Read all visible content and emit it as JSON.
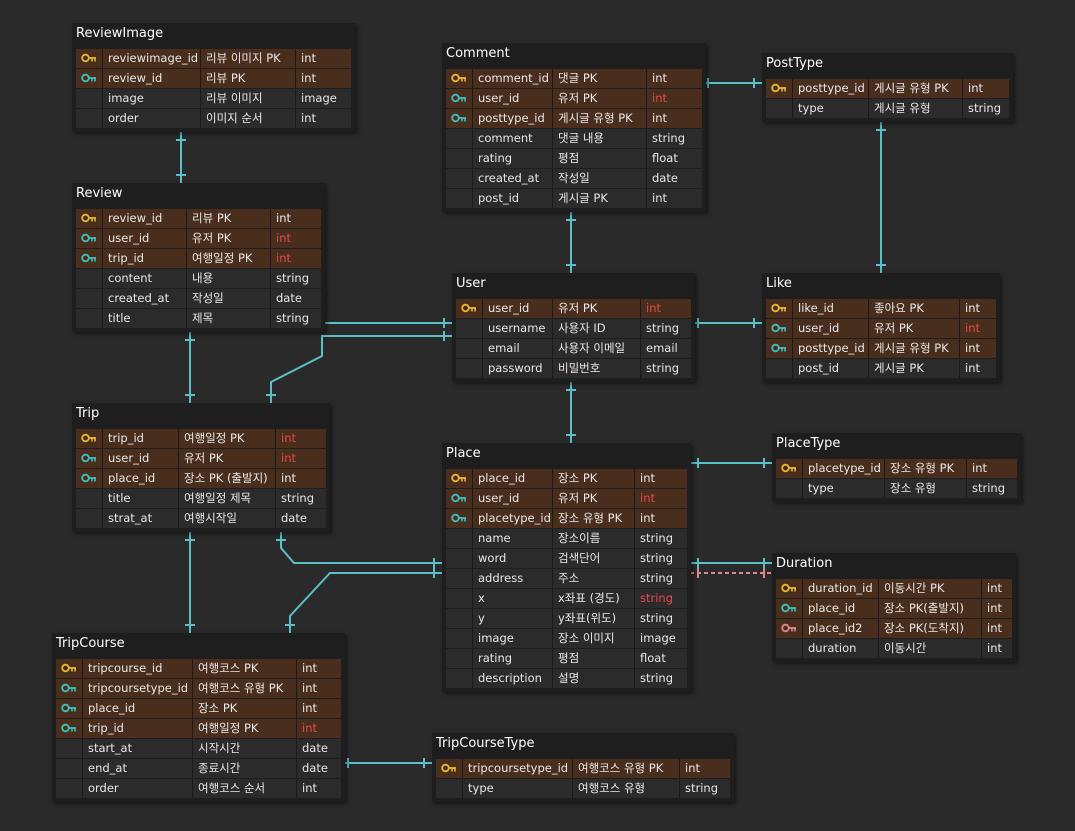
{
  "colors": {
    "background": "#2a2a2a",
    "table": "#1e1e1e",
    "key_row": "#4a2e1d",
    "cell": "#2b2b2b",
    "link": "#5bc0c8",
    "pk_icon": "#e8b830",
    "fk_icon": "#3cc0c0",
    "fk2_icon": "#e08890",
    "red_type": "#e34a4a"
  },
  "tables": [
    {
      "id": "ReviewImage",
      "title": "ReviewImage",
      "rows": [
        {
          "key": "pk",
          "name": "reviewimage_id",
          "desc": "리뷰 이미지 PK",
          "type": "int"
        },
        {
          "key": "fk",
          "name": "review_id",
          "desc": "리뷰 PK",
          "type": "int"
        },
        {
          "key": "",
          "name": "image",
          "desc": "리뷰 이미지",
          "type": "image"
        },
        {
          "key": "",
          "name": "order",
          "desc": "이미지 순서",
          "type": "int"
        }
      ]
    },
    {
      "id": "Review",
      "title": "Review",
      "rows": [
        {
          "key": "pk",
          "name": "review_id",
          "desc": "리뷰 PK",
          "type": "int"
        },
        {
          "key": "fk",
          "name": "user_id",
          "desc": "유저 PK",
          "type": "int",
          "red": true
        },
        {
          "key": "fk",
          "name": "trip_id",
          "desc": "여행일정 PK",
          "type": "int",
          "red": true
        },
        {
          "key": "",
          "name": "content",
          "desc": "내용",
          "type": "string"
        },
        {
          "key": "",
          "name": "created_at",
          "desc": "작성일",
          "type": "date"
        },
        {
          "key": "",
          "name": "title",
          "desc": "제목",
          "type": "string"
        }
      ]
    },
    {
      "id": "Trip",
      "title": "Trip",
      "rows": [
        {
          "key": "pk",
          "name": "trip_id",
          "desc": "여행일정 PK",
          "type": "int",
          "red": true
        },
        {
          "key": "fk",
          "name": "user_id",
          "desc": "유저 PK",
          "type": "int",
          "red": true
        },
        {
          "key": "fk",
          "name": "place_id",
          "desc": "장소 PK (출발지)",
          "type": "int"
        },
        {
          "key": "",
          "name": "title",
          "desc": "여행일정 제목",
          "type": "string"
        },
        {
          "key": "",
          "name": "strat_at",
          "desc": "여행시작일",
          "type": "date"
        }
      ]
    },
    {
      "id": "TripCourse",
      "title": "TripCourse",
      "rows": [
        {
          "key": "pk",
          "name": "tripcourse_id",
          "desc": "여행코스 PK",
          "type": "int"
        },
        {
          "key": "fk",
          "name": "tripcoursetype_id",
          "desc": "여행코스 유형 PK",
          "type": "int"
        },
        {
          "key": "fk",
          "name": "place_id",
          "desc": "장소 PK",
          "type": "int"
        },
        {
          "key": "fk",
          "name": "trip_id",
          "desc": "여행일정 PK",
          "type": "int",
          "red": true
        },
        {
          "key": "",
          "name": "start_at",
          "desc": "시작시간",
          "type": "date"
        },
        {
          "key": "",
          "name": "end_at",
          "desc": "종료시간",
          "type": "date"
        },
        {
          "key": "",
          "name": "order",
          "desc": "여행코스 순서",
          "type": "int"
        }
      ]
    },
    {
      "id": "Comment",
      "title": "Comment",
      "rows": [
        {
          "key": "pk",
          "name": "comment_id",
          "desc": "댓글 PK",
          "type": "int"
        },
        {
          "key": "fk",
          "name": "user_id",
          "desc": "유저 PK",
          "type": "int",
          "red": true
        },
        {
          "key": "fk",
          "name": "posttype_id",
          "desc": "게시글 유형 PK",
          "type": "int"
        },
        {
          "key": "",
          "name": "comment",
          "desc": "댓글 내용",
          "type": "string"
        },
        {
          "key": "",
          "name": "rating",
          "desc": "평점",
          "type": "float"
        },
        {
          "key": "",
          "name": "created_at",
          "desc": "작성일",
          "type": "date"
        },
        {
          "key": "",
          "name": "post_id",
          "desc": "게시글 PK",
          "type": "int"
        }
      ]
    },
    {
      "id": "User",
      "title": "User",
      "rows": [
        {
          "key": "pk",
          "name": "user_id",
          "desc": "유저 PK",
          "type": "int",
          "red": true
        },
        {
          "key": "",
          "name": "username",
          "desc": "사용자 ID",
          "type": "string"
        },
        {
          "key": "",
          "name": "email",
          "desc": "사용자 이메일",
          "type": "email"
        },
        {
          "key": "",
          "name": "password",
          "desc": "비밀번호",
          "type": "string"
        }
      ]
    },
    {
      "id": "Place",
      "title": "Place",
      "rows": [
        {
          "key": "pk",
          "name": "place_id",
          "desc": "장소 PK",
          "type": "int"
        },
        {
          "key": "fk",
          "name": "user_id",
          "desc": "유저 PK",
          "type": "int",
          "red": true
        },
        {
          "key": "fk",
          "name": "placetype_id",
          "desc": "장소 유형 PK",
          "type": "int"
        },
        {
          "key": "",
          "name": "name",
          "desc": "장소이름",
          "type": "string"
        },
        {
          "key": "",
          "name": "word",
          "desc": "검색단어",
          "type": "string"
        },
        {
          "key": "",
          "name": "address",
          "desc": "주소",
          "type": "string"
        },
        {
          "key": "",
          "name": "x",
          "desc": "x좌표 (경도)",
          "type": "string",
          "red": true
        },
        {
          "key": "",
          "name": "y",
          "desc": "y좌표(위도)",
          "type": "string"
        },
        {
          "key": "",
          "name": "image",
          "desc": "장소 이미지",
          "type": "image"
        },
        {
          "key": "",
          "name": "rating",
          "desc": "평점",
          "type": "float"
        },
        {
          "key": "",
          "name": "description",
          "desc": "설명",
          "type": "string"
        }
      ]
    },
    {
      "id": "TripCourseType",
      "title": "TripCourseType",
      "rows": [
        {
          "key": "pk",
          "name": "tripcoursetype_id",
          "desc": "여행코스 유형 PK",
          "type": "int"
        },
        {
          "key": "",
          "name": "type",
          "desc": "여행코스 유형",
          "type": "string"
        }
      ]
    },
    {
      "id": "PostType",
      "title": "PostType",
      "rows": [
        {
          "key": "pk",
          "name": "posttype_id",
          "desc": "게시글 유형 PK",
          "type": "int"
        },
        {
          "key": "",
          "name": "type",
          "desc": "게시글 유형",
          "type": "string"
        }
      ]
    },
    {
      "id": "Like",
      "title": "Like",
      "rows": [
        {
          "key": "pk",
          "name": "like_id",
          "desc": "좋아요 PK",
          "type": "int"
        },
        {
          "key": "fk",
          "name": "user_id",
          "desc": "유저 PK",
          "type": "int",
          "red": true
        },
        {
          "key": "fk",
          "name": "posttype_id",
          "desc": "게시글 유형 PK",
          "type": "int"
        },
        {
          "key": "",
          "name": "post_id",
          "desc": "게시글 PK",
          "type": "int"
        }
      ]
    },
    {
      "id": "PlaceType",
      "title": "PlaceType",
      "rows": [
        {
          "key": "pk",
          "name": "placetype_id",
          "desc": "장소 유형 PK",
          "type": "int"
        },
        {
          "key": "",
          "name": "type",
          "desc": "장소 유형",
          "type": "string"
        }
      ]
    },
    {
      "id": "Duration",
      "title": "Duration",
      "rows": [
        {
          "key": "pk",
          "name": "duration_id",
          "desc": "이동시간 PK",
          "type": "int"
        },
        {
          "key": "fk",
          "name": "place_id",
          "desc": "장소 PK(출발지)",
          "type": "int"
        },
        {
          "key": "fk2",
          "name": "place_id2",
          "desc": "장소 PK(도착지)",
          "type": "int"
        },
        {
          "key": "",
          "name": "duration",
          "desc": "이동시간",
          "type": "int"
        }
      ]
    }
  ]
}
